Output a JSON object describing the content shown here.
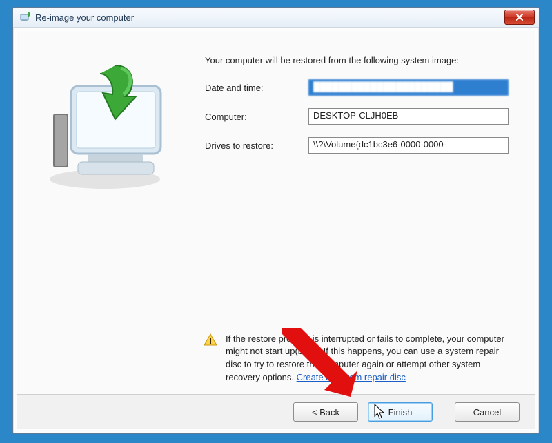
{
  "window": {
    "title": "Re-image your computer"
  },
  "main": {
    "intro": "Your computer will be restored from the following system image:",
    "rows": {
      "datetime_label": "Date and time:",
      "datetime_value": "██████████████████████",
      "computer_label": "Computer:",
      "computer_value": "DESKTOP-CLJH0EB",
      "drives_label": "Drives to restore:",
      "drives_value": "\\\\?\\Volume{dc1bc3e6-0000-0000-"
    }
  },
  "warning": {
    "text": "If the restore process is interrupted or fails to complete, your computer might not start up(boot). If this happens, you can use a system repair disc to try to restore the computer again or attempt other system recovery options.",
    "link": "Create a system repair disc"
  },
  "buttons": {
    "back": "< Back",
    "finish": "Finish",
    "cancel": "Cancel"
  }
}
